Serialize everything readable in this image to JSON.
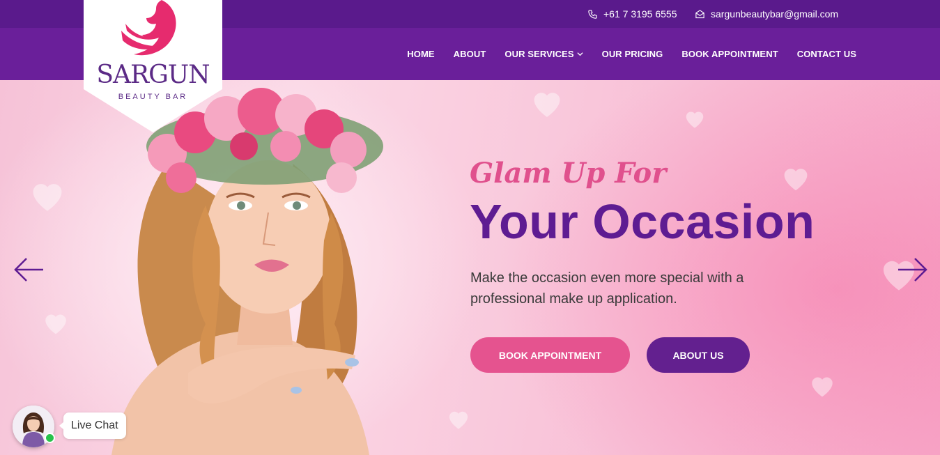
{
  "topbar": {
    "phone": "+61 7 3195 6555",
    "email": "sargunbeautybar@gmail.com",
    "phone_icon": "phone-icon",
    "email_icon": "envelope-icon"
  },
  "logo": {
    "name": "SARGUN",
    "subtitle": "BEAUTY BAR",
    "icon": "woman-silhouette-logo"
  },
  "nav": {
    "items": [
      {
        "label": "HOME"
      },
      {
        "label": "ABOUT"
      },
      {
        "label": "OUR SERVICES",
        "icon": "chevron-down-icon"
      },
      {
        "label": "OUR PRICING"
      },
      {
        "label": "BOOK APPOINTMENT"
      },
      {
        "label": "CONTACT US"
      }
    ]
  },
  "hero": {
    "tagline": "Glam Up For",
    "headline": "Your Occasion",
    "description": "Make the occasion even more special with a professional make up application.",
    "buttons": {
      "book": "BOOK APPOINTMENT",
      "about": "ABOUT US"
    },
    "prev_icon": "arrow-left-icon",
    "next_icon": "arrow-right-icon"
  },
  "chat": {
    "label": "Live Chat",
    "status": "online"
  },
  "colors": {
    "topbar": "#5a1a8c",
    "navbar": "#6a1f9a",
    "headline": "#5e1c92",
    "tagline": "#e0508d",
    "button_pink": "#e5538f",
    "button_purple": "#63208f",
    "online": "#27c24c"
  }
}
